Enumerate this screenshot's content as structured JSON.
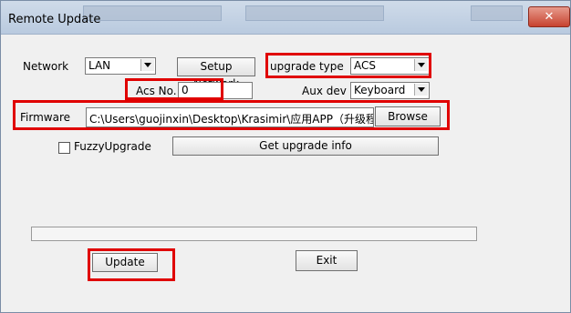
{
  "window": {
    "title": "Remote Update",
    "close_icon": "close-icon"
  },
  "network": {
    "label": "Network",
    "value": "LAN",
    "setup_button": "Setup Network"
  },
  "upgrade_type": {
    "label": "upgrade type",
    "value": "ACS"
  },
  "acs_no": {
    "label": "Acs No.",
    "value": "0"
  },
  "aux_dev": {
    "label": "Aux dev",
    "value": "Keyboard"
  },
  "firmware": {
    "label": "Firmware",
    "path": "C:\\Users\\guojinxin\\Desktop\\Krasimir\\应用APP（升级程",
    "browse_button": "Browse"
  },
  "fuzzy": {
    "label": "FuzzyUpgrade",
    "checked": false
  },
  "get_info_button": "Get upgrade info",
  "progress": {
    "value": 0
  },
  "buttons": {
    "update": "Update",
    "exit": "Exit"
  },
  "colors": {
    "highlight": "#e00000",
    "close": "#c7422f"
  }
}
